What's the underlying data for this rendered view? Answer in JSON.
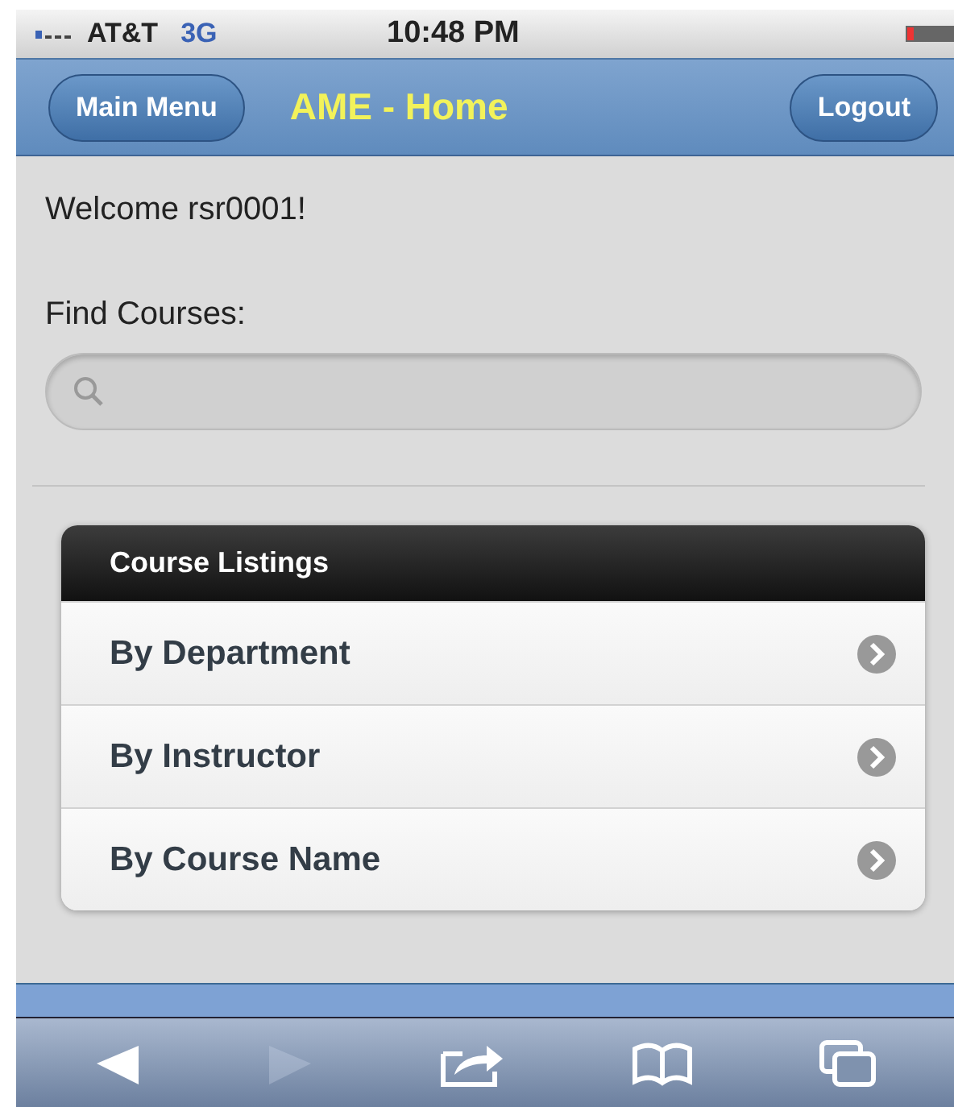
{
  "status_bar": {
    "carrier": "AT&T",
    "network": "3G",
    "time": "10:48 PM"
  },
  "header": {
    "left_button": "Main Menu",
    "title": "AME - Home",
    "right_button": "Logout"
  },
  "welcome": "Welcome rsr0001!",
  "search": {
    "label": "Find Courses:"
  },
  "course_listings": {
    "title": "Course Listings",
    "items": [
      {
        "label": "By Department"
      },
      {
        "label": "By Instructor"
      },
      {
        "label": "By Course Name"
      }
    ]
  },
  "toolbar": [
    {
      "kind": "back",
      "disabled": false
    },
    {
      "kind": "forward",
      "disabled": true
    },
    {
      "kind": "share",
      "disabled": false
    },
    {
      "kind": "bookmarks",
      "disabled": false
    },
    {
      "kind": "tabs",
      "disabled": false
    }
  ]
}
